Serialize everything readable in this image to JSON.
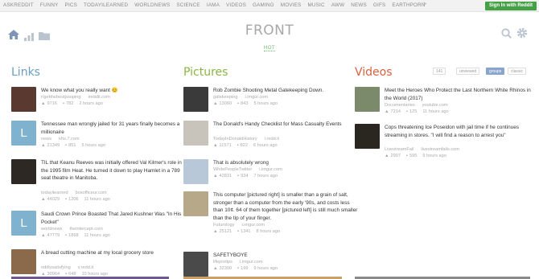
{
  "topbar": {
    "subreddits": [
      "ASKREDDIT",
      "FUNNY",
      "PICS",
      "TODAYILEARNED",
      "WORLDNEWS",
      "SCIENCE",
      "IAMA",
      "VIDEOS",
      "GAMING",
      "MOVIES",
      "MUSIC",
      "AWW",
      "NEWS",
      "GIFS",
      "EARTHPORN"
    ],
    "more": ">",
    "signin": "Sign In with Reddit"
  },
  "header": {
    "logo": "FRONT",
    "sort": "HOT"
  },
  "links": {
    "title": "Links",
    "posts": [
      {
        "title": "We know what you really want 😊",
        "sub": "r/getthebestpooping",
        "meta2": "ireddit.com",
        "score": "9716",
        "comments": "782",
        "time": "2 hours ago",
        "thumb_color": "#5a3a30"
      },
      {
        "title": "Tennessee man wrongly jailed for 31 years finally becomes a millionaire",
        "sub": "news",
        "meta2": "khs.7.com",
        "score": "21349",
        "comments": "851",
        "time": "5 hours ago",
        "letter": "L"
      },
      {
        "title": "TIL that Keanu Reeves was initially offered Val Kilmer's role in the 1995 film Heat. He turned it down to play Hamlet in a 789 seat theatre in Manitoba.",
        "sub": "todayilearned",
        "meta2": "boxofficeur.com",
        "score": "44029",
        "comments": "1206",
        "time": "11 hours ago",
        "thumb_color": "#2e2824"
      },
      {
        "title": "Saudi Crown Prince Boasted That Jared Kushner Was \"In His Pocket\"",
        "sub": "worldnews",
        "meta2": "theintercept.com",
        "score": "47779",
        "comments": "1868",
        "time": "11 hours ago",
        "letter": "L"
      },
      {
        "title": "A bread cutting machine at my local grocery store",
        "sub": "oddlysatisfying",
        "meta2": "v.redd.it",
        "score": "30964",
        "comments": "648",
        "time": "10 hours ago",
        "thumb_color": "#8a6a4a"
      }
    ]
  },
  "pictures": {
    "title": "Pictures",
    "posts": [
      {
        "title": "Rob Zombie Shooting Metal Gatekeeping Down.",
        "sub": "gatekeeping",
        "meta2": "i.imgur.com",
        "score": "13060",
        "comments": "843",
        "time": "5 hours ago",
        "thumb_color": "#3a3a3a"
      },
      {
        "title": "The Donald's Handy Checklist for Mass Casualty Events",
        "sub": "TodayInDonaldHistory",
        "meta2": "i.redd.it",
        "score": "11571",
        "comments": "822",
        "time": "6 hours ago",
        "thumb_color": "#c8c4bc"
      },
      {
        "title": "That is absolutely wrong",
        "sub": "WhitePeopleTwitter",
        "meta2": "i.imgur.com",
        "score": "42831",
        "comments": "934",
        "time": "7 hours ago",
        "thumb_color": "#b8c8d8"
      },
      {
        "title": "This computer [pictured right] is smaller than a grain of salt, stronger than a computer from the early '90s, and costs less than 10¢. 64 of them together [pictured left] is still much smaller than the tip of your finger.",
        "sub": "Futurology",
        "meta2": "i.imgur.com",
        "score": "25121",
        "comments": "1341",
        "time": "8 hours ago",
        "thumb_color": "#b8a88a"
      },
      {
        "title": "SAFETYBOYE",
        "sub": "lifeprotips",
        "meta2": "i.imgur.com",
        "score": "32300",
        "comments": "199",
        "time": "9 hours ago",
        "thumb_color": "#4a4a4a"
      }
    ]
  },
  "videos": {
    "title": "Videos",
    "toggles": [
      "141",
      "unviewed",
      "groups",
      "classic"
    ],
    "posts": [
      {
        "title": "Meet the Heroes Who Protect the Last Northern White Rhinos in the World (2017)",
        "sub": "Documentaries",
        "meta2": "youtube.com",
        "score": "7214",
        "comments": "125",
        "time": "11 hours ago",
        "thumb_color": "#7a8a6a"
      },
      {
        "title": "Cops threatening Ice Poseidon with jail time if he continues streaming in stores. \"I will find a reason to arrest you\"",
        "sub": "LivestreamFail",
        "meta2": "livestreamfails.com",
        "score": "2907",
        "comments": "595",
        "time": "9 hours ago",
        "thumb_color": "#2a2620"
      }
    ]
  },
  "colors": {
    "links": "#6a9ec2",
    "pictures": "#89b545",
    "videos": "#d9603e",
    "signin": "#46a046"
  }
}
